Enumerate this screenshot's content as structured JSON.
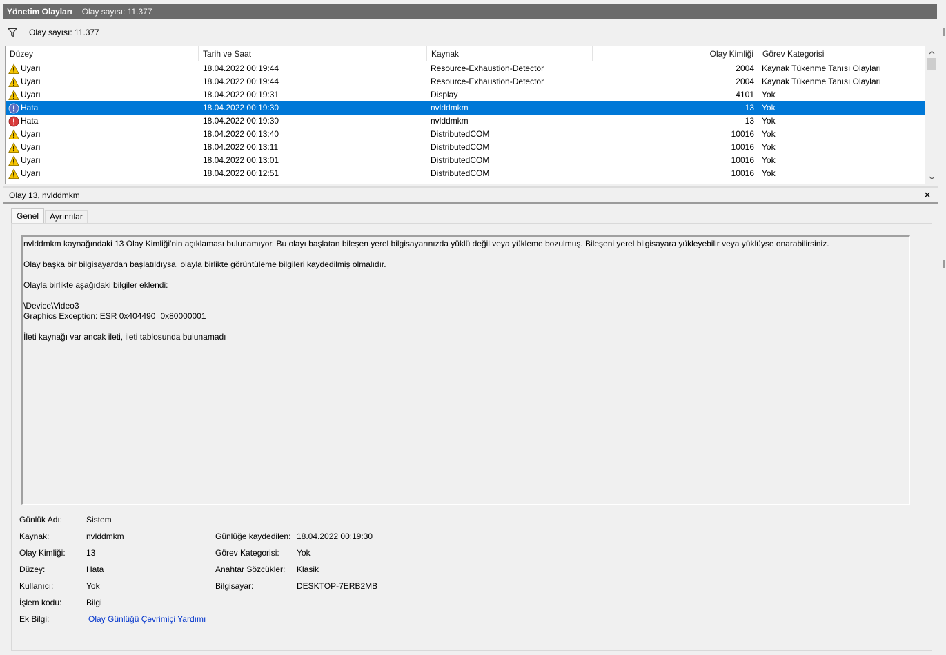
{
  "header": {
    "title": "Yönetim Olayları",
    "count_text": "Olay sayısı: 11.377"
  },
  "filter": {
    "text": "Olay sayısı: 11.377",
    "icon": "filter-icon"
  },
  "grid": {
    "columns": [
      "Düzey",
      "Tarih ve Saat",
      "Kaynak",
      "Olay Kimliği",
      "Görev Kategorisi"
    ],
    "rows": [
      {
        "level": "Uyarı",
        "icon": "warning-icon",
        "date": "18.04.2022 00:19:44",
        "source": "Resource-Exhaustion-Detector",
        "event_id": "2004",
        "task": "Kaynak Tükenme Tanısı Olayları",
        "selected": false
      },
      {
        "level": "Uyarı",
        "icon": "warning-icon",
        "date": "18.04.2022 00:19:44",
        "source": "Resource-Exhaustion-Detector",
        "event_id": "2004",
        "task": "Kaynak Tükenme Tanısı Olayları",
        "selected": false
      },
      {
        "level": "Uyarı",
        "icon": "warning-icon",
        "date": "18.04.2022 00:19:31",
        "source": "Display",
        "event_id": "4101",
        "task": "Yok",
        "selected": false
      },
      {
        "level": "Hata",
        "icon": "error-icon",
        "date": "18.04.2022 00:19:30",
        "source": "nvlddmkm",
        "event_id": "13",
        "task": "Yok",
        "selected": true
      },
      {
        "level": "Hata",
        "icon": "error-icon",
        "date": "18.04.2022 00:19:30",
        "source": "nvlddmkm",
        "event_id": "13",
        "task": "Yok",
        "selected": false
      },
      {
        "level": "Uyarı",
        "icon": "warning-icon",
        "date": "18.04.2022 00:13:40",
        "source": "DistributedCOM",
        "event_id": "10016",
        "task": "Yok",
        "selected": false
      },
      {
        "level": "Uyarı",
        "icon": "warning-icon",
        "date": "18.04.2022 00:13:11",
        "source": "DistributedCOM",
        "event_id": "10016",
        "task": "Yok",
        "selected": false
      },
      {
        "level": "Uyarı",
        "icon": "warning-icon",
        "date": "18.04.2022 00:13:01",
        "source": "DistributedCOM",
        "event_id": "10016",
        "task": "Yok",
        "selected": false
      },
      {
        "level": "Uyarı",
        "icon": "warning-icon",
        "date": "18.04.2022 00:12:51",
        "source": "DistributedCOM",
        "event_id": "10016",
        "task": "Yok",
        "selected": false
      }
    ]
  },
  "detail": {
    "title": "Olay 13, nvlddmkm",
    "close_glyph": "✕",
    "tabs": [
      "Genel",
      "Ayrıntılar"
    ],
    "active_tab": "Genel",
    "description": [
      "nvlddmkm kaynağındaki 13 Olay Kimliği'nin açıklaması bulunamıyor. Bu olayı başlatan bileşen yerel bilgisayarınızda yüklü değil veya yükleme bozulmuş. Bileşeni yerel bilgisayara yükleyebilir veya yüklüyse onarabilirsiniz.",
      "Olay başka bir bilgisayardan başlatıldıysa, olayla birlikte görüntüleme bilgileri kaydedilmiş olmalıdır.",
      "Olayla birlikte aşağıdaki bilgiler eklendi:",
      "\\Device\\Video3\nGraphics Exception: ESR 0x404490=0x80000001",
      "İleti kaynağı var ancak ileti, ileti tablosunda bulunamadı"
    ],
    "props": {
      "log_name_label": "Günlük Adı:",
      "log_name": "Sistem",
      "source_label": "Kaynak:",
      "source": "nvlddmkm",
      "logged_label": "Günlüğe kaydedilen:",
      "logged": "18.04.2022 00:19:30",
      "event_id_label": "Olay Kimliği:",
      "event_id": "13",
      "task_label": "Görev Kategorisi:",
      "task": "Yok",
      "level_label": "Düzey:",
      "level": "Hata",
      "keywords_label": "Anahtar Sözcükler:",
      "keywords": "Klasik",
      "user_label": "Kullanıcı:",
      "user": "Yok",
      "computer_label": "Bilgisayar:",
      "computer": "DESKTOP-7ERB2MB",
      "opcode_label": "İşlem kodu:",
      "opcode": "Bilgi",
      "more_info_label": "Ek Bilgi:",
      "more_info_link": "Olay Günlüğü Çevrimiçi Yardımı"
    }
  },
  "colors": {
    "title_bg": "#6b6b6b",
    "selection": "#0078d7",
    "warning": "#f5c400",
    "error": "#d83b3b",
    "link": "#0033cc"
  }
}
